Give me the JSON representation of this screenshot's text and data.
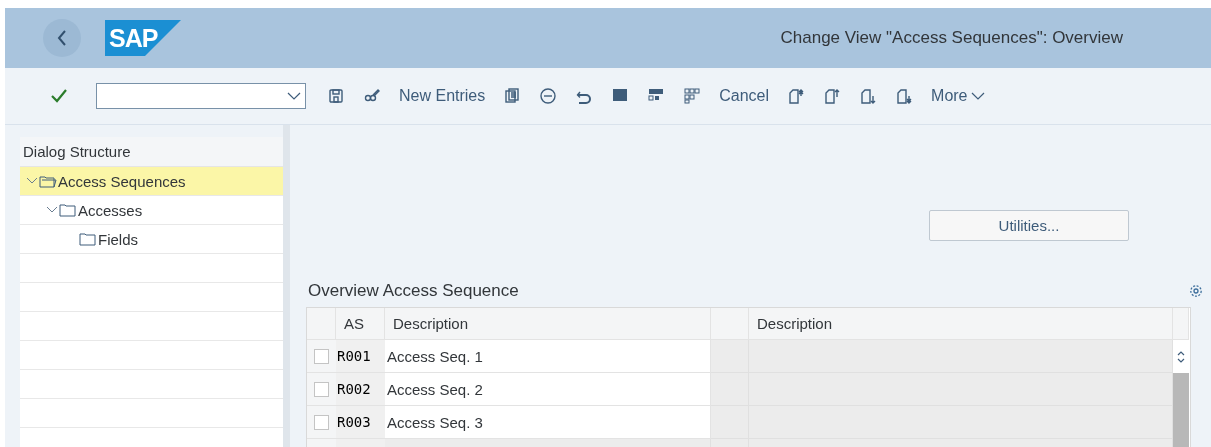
{
  "shell": {
    "title": "Change View \"Access Sequences\": Overview",
    "logo": "SAP"
  },
  "toolbar": {
    "items": [
      {
        "kind": "icon"
      },
      {
        "kind": "icon"
      },
      {
        "kind": "text",
        "label": "New Entries"
      },
      {
        "kind": "icon"
      },
      {
        "kind": "icon"
      },
      {
        "kind": "icon"
      },
      {
        "kind": "icon"
      },
      {
        "kind": "icon"
      },
      {
        "kind": "icon"
      },
      {
        "kind": "text",
        "label": "Cancel"
      },
      {
        "kind": "icon"
      },
      {
        "kind": "icon"
      },
      {
        "kind": "icon"
      },
      {
        "kind": "icon"
      },
      {
        "kind": "menu",
        "label": "More"
      }
    ]
  },
  "dialog_structure": {
    "title": "Dialog Structure",
    "items": [
      {
        "label": "Access Sequences",
        "selected": true,
        "expanded": true,
        "children": [
          {
            "label": "Accesses",
            "selected": false,
            "expanded": true,
            "children": [
              {
                "label": "Fields",
                "selected": false,
                "expanded": false
              }
            ]
          }
        ]
      }
    ]
  },
  "utilities_button": "Utilities...",
  "table": {
    "title": "Overview Access Sequence",
    "columns": [
      "AS",
      "Description",
      "",
      "Description"
    ],
    "rows": [
      {
        "selected": false,
        "as": "R001",
        "description": "Access Seq. 1"
      },
      {
        "selected": false,
        "as": "R002",
        "description": "Access Seq. 2"
      },
      {
        "selected": false,
        "as": "R003",
        "description": "Access Seq. 3"
      }
    ]
  }
}
